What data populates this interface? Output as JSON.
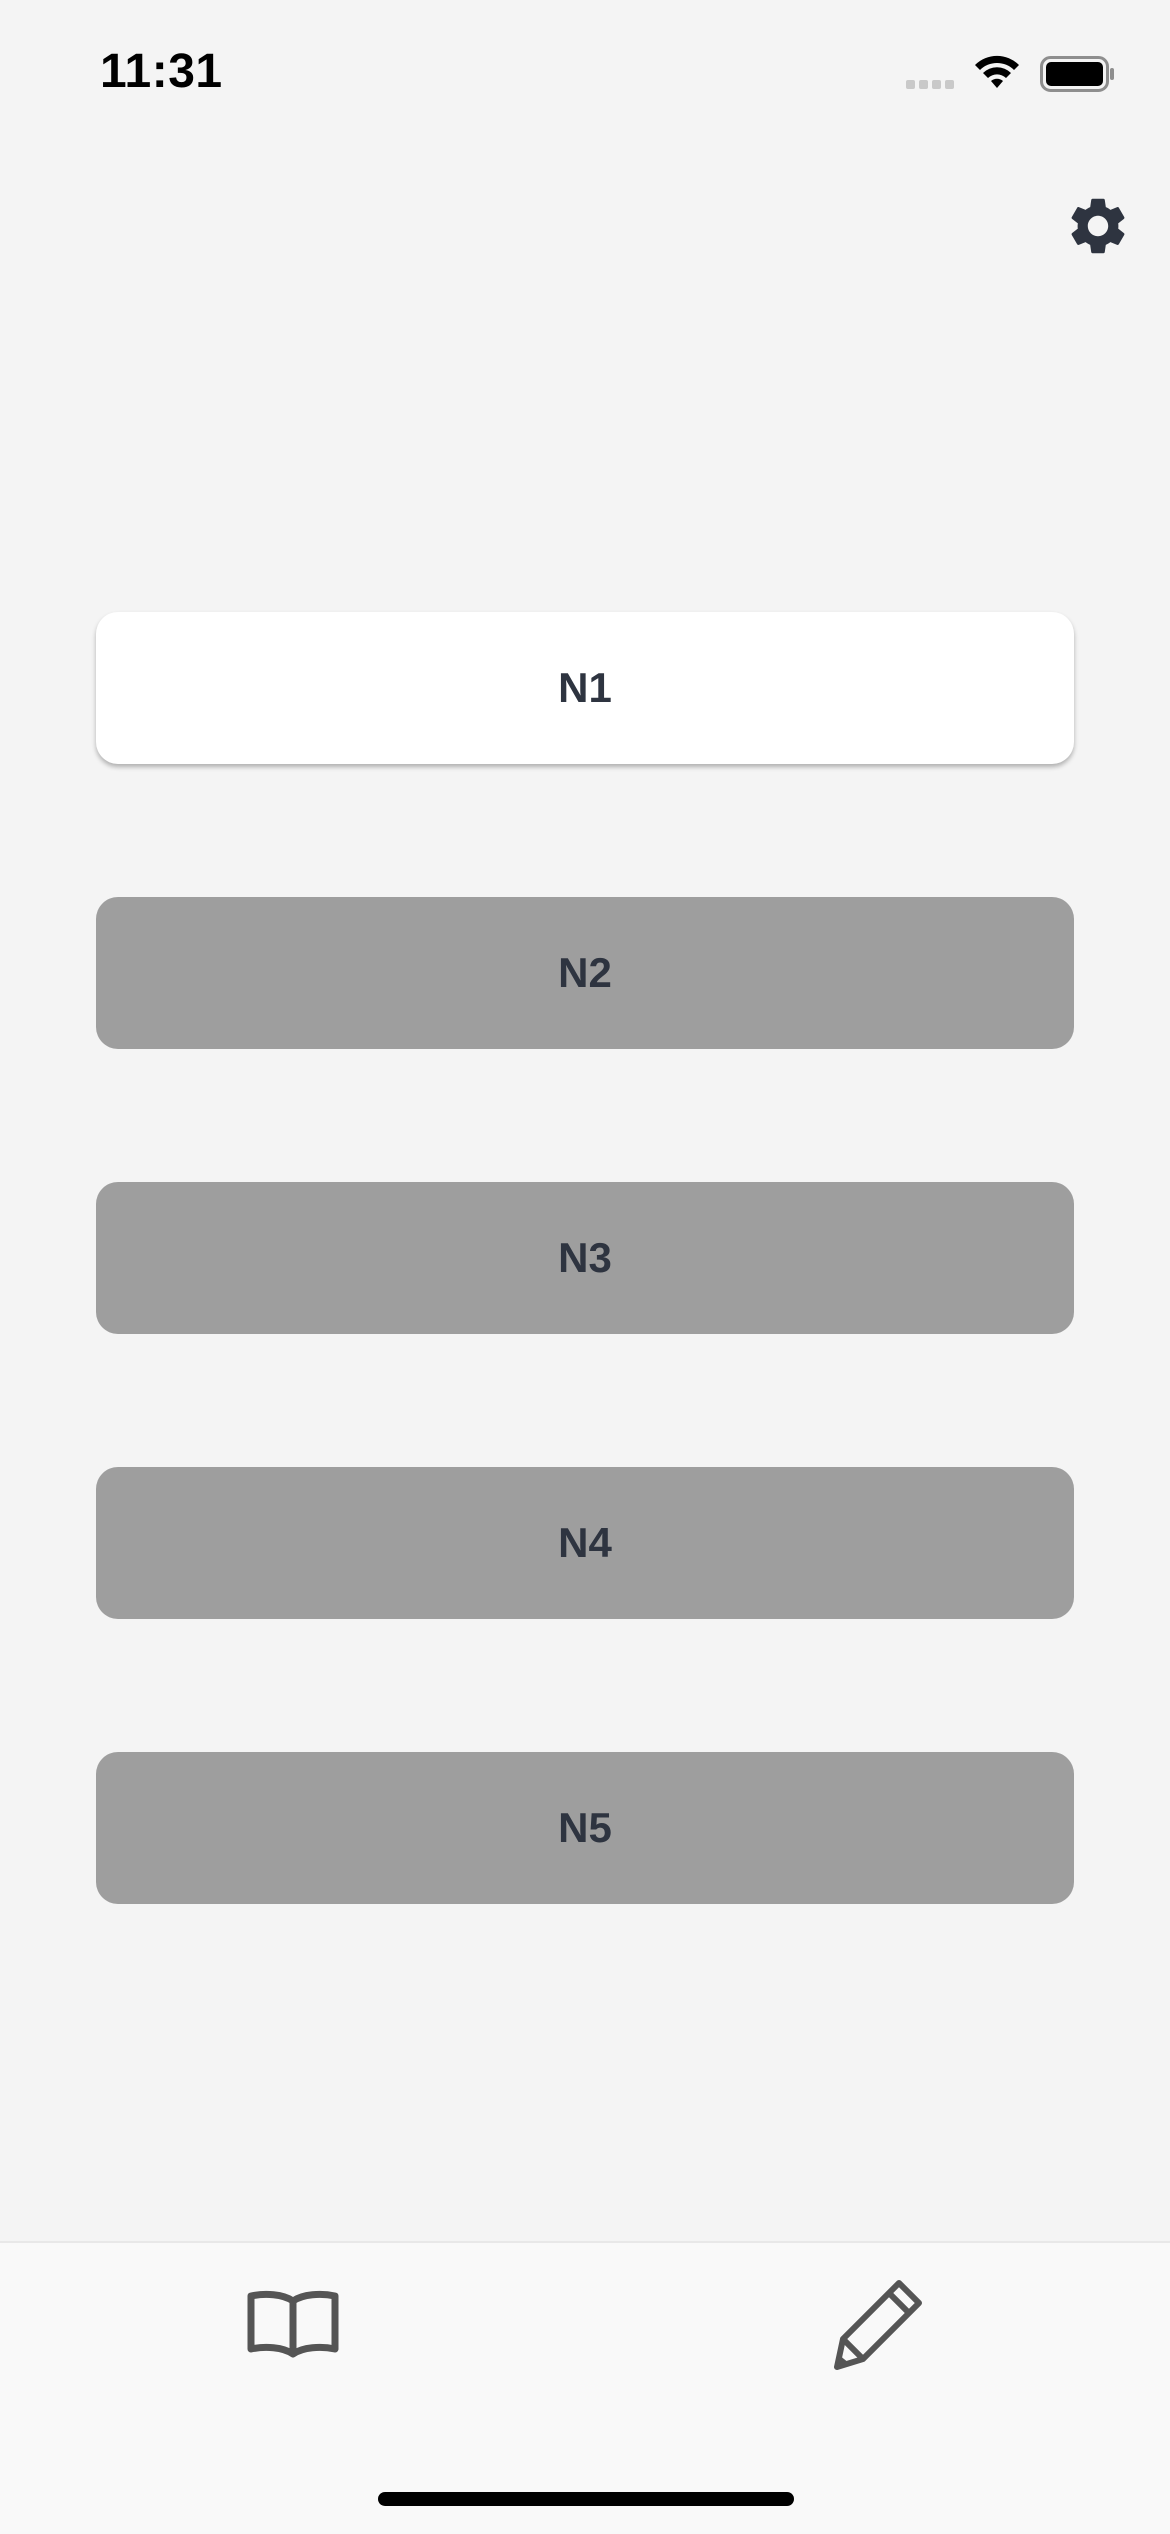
{
  "status_bar": {
    "time": "11:31",
    "signal_icon": "cellular-signal-icon",
    "wifi_icon": "wifi-icon",
    "battery_icon": "battery-icon"
  },
  "header": {
    "settings_icon": "gear-icon"
  },
  "levels": [
    {
      "label": "N1",
      "active": true
    },
    {
      "label": "N2",
      "active": false
    },
    {
      "label": "N3",
      "active": false
    },
    {
      "label": "N4",
      "active": false
    },
    {
      "label": "N5",
      "active": false
    }
  ],
  "tab_bar": {
    "tabs": [
      {
        "icon": "book-icon"
      },
      {
        "icon": "pencil-icon"
      }
    ]
  },
  "colors": {
    "background": "#f4f4f4",
    "active_button": "#ffffff",
    "inactive_button": "#9e9e9e",
    "label_text": "#2e3440",
    "tab_icon": "#555555"
  }
}
